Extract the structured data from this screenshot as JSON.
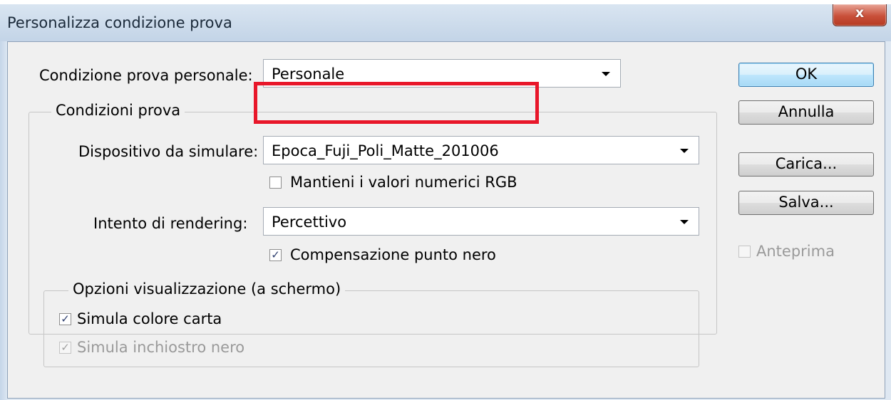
{
  "dialog": {
    "title": "Personalizza condizione prova",
    "close_label": "x"
  },
  "custom_condition": {
    "label": "Condizione prova personale:",
    "value": "Personale"
  },
  "proof_conditions": {
    "group_title": "Condizioni prova",
    "device_label": "Dispositivo da simulare:",
    "device_value": "Epoca_Fuji_Poli_Matte_201006",
    "preserve_rgb_label": "Mantieni i valori numerici RGB",
    "preserve_rgb_checked": false,
    "intent_label": "Intento di rendering:",
    "intent_value": "Percettivo",
    "black_point_label": "Compensazione punto nero",
    "black_point_checked": true
  },
  "display_options": {
    "group_title": "Opzioni visualizzazione (a schermo)",
    "paper_color_label": "Simula colore carta",
    "paper_color_checked": true,
    "black_ink_label": "Simula inchiostro nero",
    "black_ink_checked": true,
    "black_ink_enabled": false
  },
  "buttons": {
    "ok": "OK",
    "cancel": "Annulla",
    "load": "Carica...",
    "save": "Salva..."
  },
  "preview": {
    "label": "Anteprima",
    "checked": false,
    "enabled": false
  },
  "check_glyph": "✓",
  "colors": {
    "highlight": "#e8172a",
    "default_button_border": "#3c7fb1"
  }
}
